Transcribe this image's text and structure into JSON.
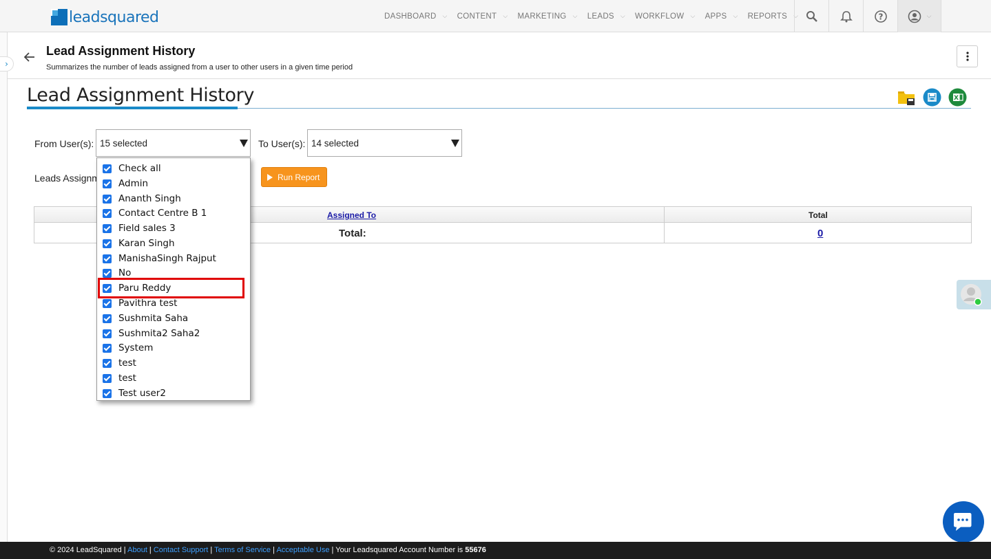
{
  "brand": {
    "name": "leadsquared"
  },
  "nav": {
    "menu": [
      "DASHBOARD",
      "CONTENT",
      "MARKETING",
      "LEADS",
      "WORKFLOW",
      "APPS",
      "REPORTS"
    ],
    "icons": [
      "search-icon",
      "bell-icon",
      "help-icon",
      "user-icon"
    ]
  },
  "header": {
    "title": "Lead Assignment History",
    "subtitle": "Summarizes the number of leads assigned from a user to other users in a given time period"
  },
  "report": {
    "title": "Lead Assignment History"
  },
  "filters": {
    "from_label": "From User(s):",
    "from_value": "15 selected",
    "to_label": "To User(s):",
    "to_value": "14 selected",
    "leads_label": "Leads Assignm",
    "run_label": "Run Report"
  },
  "dropdown": {
    "items": [
      {
        "label": "Check all",
        "checked": true
      },
      {
        "label": "Admin",
        "checked": true
      },
      {
        "label": "Ananth Singh",
        "checked": true
      },
      {
        "label": "Contact Centre B 1",
        "checked": true
      },
      {
        "label": "Field sales 3",
        "checked": true
      },
      {
        "label": "Karan Singh",
        "checked": true
      },
      {
        "label": "ManishaSingh Rajput",
        "checked": true
      },
      {
        "label": "No",
        "checked": true
      },
      {
        "label": "Paru Reddy",
        "checked": true
      },
      {
        "label": "Pavithra test",
        "checked": true
      },
      {
        "label": "Sushmita Saha",
        "checked": true
      },
      {
        "label": "Sushmita2 Saha2",
        "checked": true
      },
      {
        "label": "System",
        "checked": true
      },
      {
        "label": "test",
        "checked": true
      },
      {
        "label": "test",
        "checked": true
      },
      {
        "label": "Test user2",
        "checked": true
      }
    ]
  },
  "table": {
    "col_assigned": "Assigned To",
    "col_total": "Total",
    "total_label": "Total:",
    "total_value": "0"
  },
  "footer": {
    "copyright": "© 2024 LeadSquared",
    "links": [
      "About",
      "Contact Support",
      "Terms of Service",
      "Acceptable Use"
    ],
    "account_text": "Your Leadsquared Account Number is",
    "account_number": "55676"
  },
  "colors": {
    "brand_blue": "#1a74bb",
    "accent": "#1a8ac8",
    "run_button": "#f7941d",
    "highlight": "#e00000",
    "footer_bg": "#1c1c1c"
  }
}
